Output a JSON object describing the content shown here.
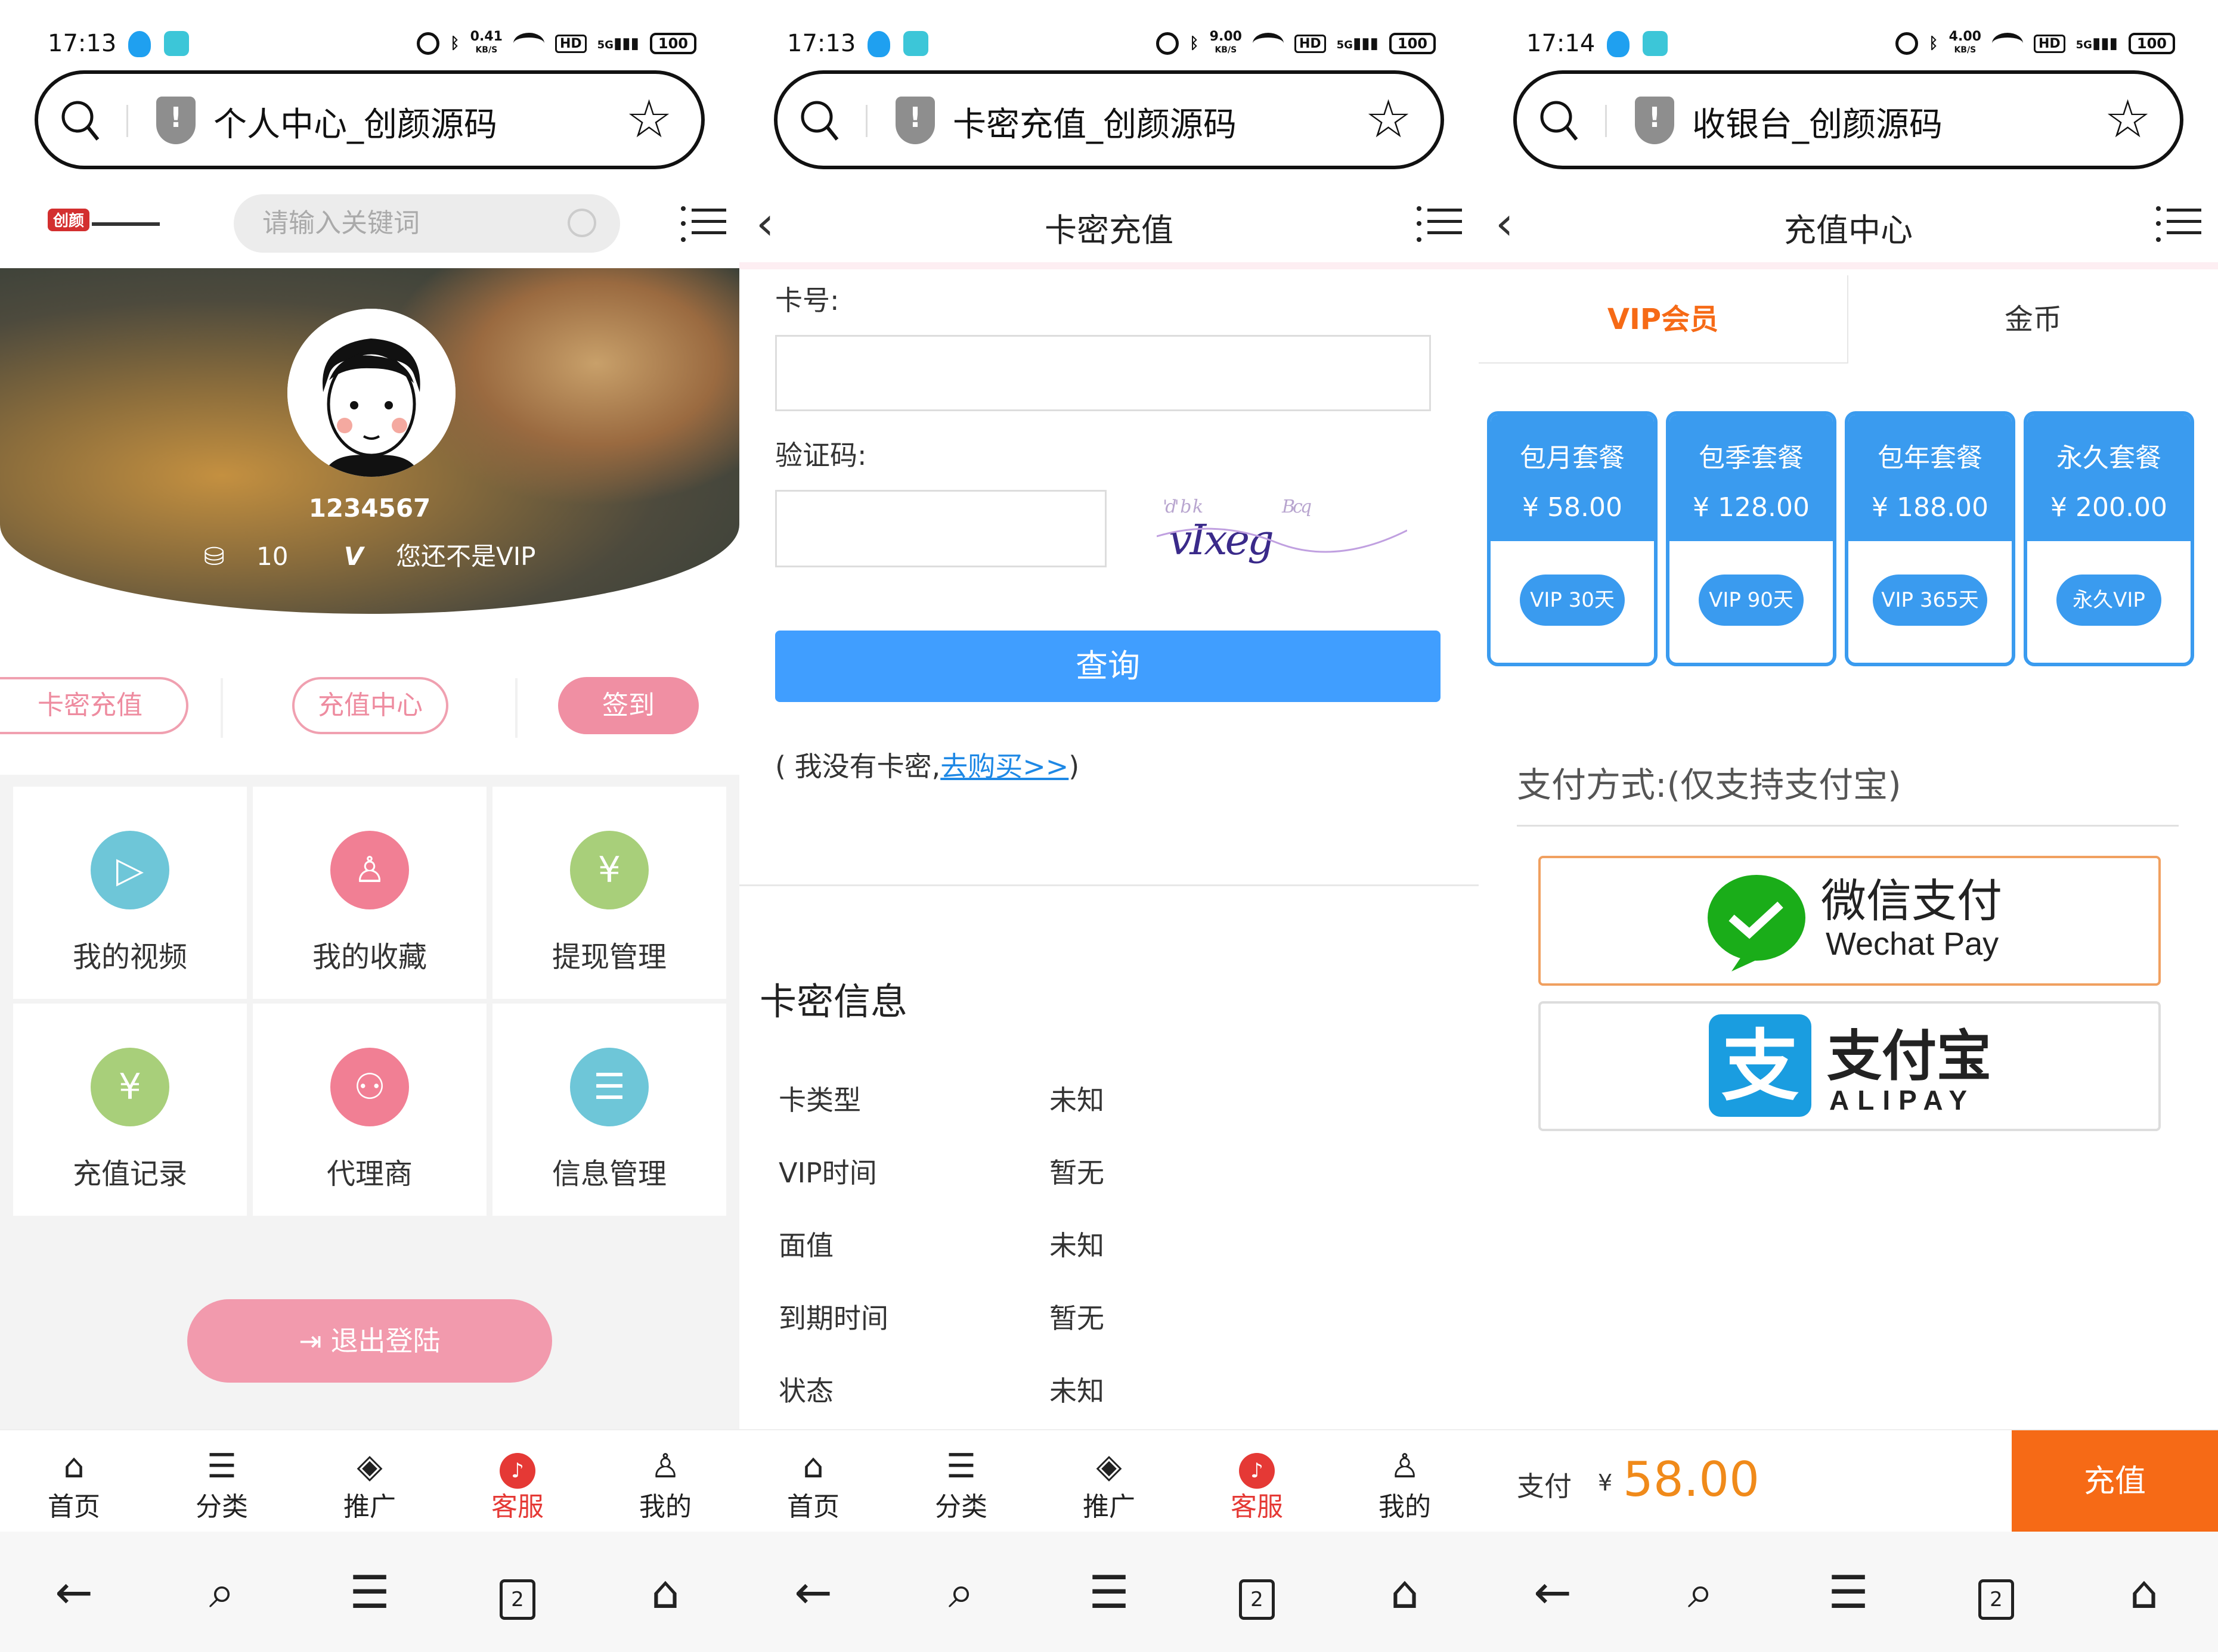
{
  "status_bars": [
    {
      "time": "17:13",
      "speed": "0.41",
      "speed_unit": "KB/S",
      "hd": "HD",
      "net": "5G",
      "battery": "100"
    },
    {
      "time": "17:13",
      "speed": "9.00",
      "speed_unit": "KB/S",
      "hd": "HD",
      "net": "5G",
      "battery": "100"
    },
    {
      "time": "17:14",
      "speed": "4.00",
      "speed_unit": "KB/S",
      "hd": "HD",
      "net": "5G",
      "battery": "100"
    }
  ],
  "url_titles": [
    "个人中心_创颜源码",
    "卡密充值_创颜源码",
    "收银台_创颜源码"
  ],
  "tabbar": [
    "首页",
    "分类",
    "推广",
    "客服",
    "我的"
  ],
  "browser_nav": {
    "tabs_count": "2"
  },
  "profile": {
    "search_placeholder": "请输入关键词",
    "username": "1234567",
    "coins": "10",
    "vip_status": "您还不是VIP",
    "buttons": [
      "卡密充值",
      "充值中心",
      "签到"
    ],
    "grid": [
      "我的视频",
      "我的收藏",
      "提现管理",
      "充值记录",
      "代理商",
      "信息管理"
    ],
    "logout": "退出登陆",
    "colors": {
      "accent": "#f08fa3"
    }
  },
  "card_recharge": {
    "header": "卡密充值",
    "card_label": "卡号:",
    "captcha_label": "验证码:",
    "captcha_text": "vIxeg",
    "query_button": "查询",
    "no_card_prefix": "( 我没有卡密,",
    "buy_link": "去购买>>",
    "no_card_suffix": ")",
    "info_title": "卡密信息",
    "info_rows": [
      {
        "label": "卡类型",
        "value": "未知"
      },
      {
        "label": "VIP时间",
        "value": "暂无"
      },
      {
        "label": "面值",
        "value": "未知"
      },
      {
        "label": "到期时间",
        "value": "暂无"
      },
      {
        "label": "状态",
        "value": "未知"
      }
    ],
    "colors": {
      "button": "#409eff"
    }
  },
  "cashier": {
    "header": "充值中心",
    "tabs": [
      "VIP会员",
      "金币"
    ],
    "packages": [
      {
        "name": "包月套餐",
        "price": "¥ 58.00",
        "badge": "VIP 30天"
      },
      {
        "name": "包季套餐",
        "price": "¥ 128.00",
        "badge": "VIP 90天"
      },
      {
        "name": "包年套餐",
        "price": "¥ 188.00",
        "badge": "VIP 365天"
      },
      {
        "name": "永久套餐",
        "price": "¥ 200.00",
        "badge": "永久VIP"
      }
    ],
    "pay_title": "支付方式:(仅支持支付宝)",
    "wechat_cn": "微信支付",
    "wechat_en": "Wechat Pay",
    "alipay_cn": "支付宝",
    "alipay_en": "ALIPAY",
    "pay_label": "支付",
    "currency": "¥",
    "amount": "58.00",
    "recharge_button": "充值",
    "colors": {
      "package": "#3a9bef",
      "cta": "#f66a16",
      "amount": "#f08a1a",
      "tab_active": "#f66a16"
    }
  }
}
